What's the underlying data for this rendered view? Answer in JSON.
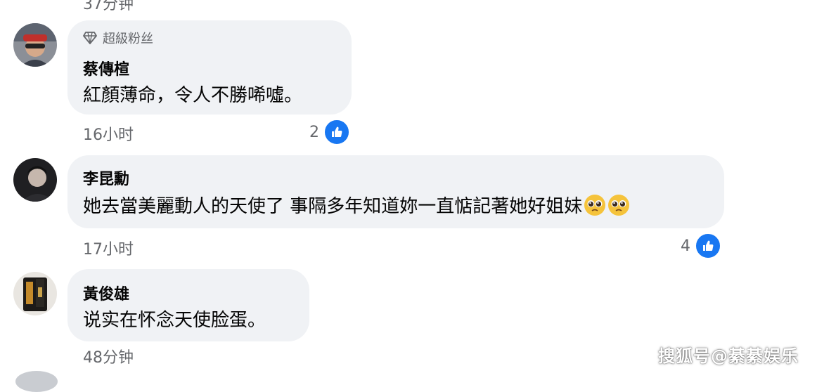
{
  "previous_comment": {
    "time": "37分钟"
  },
  "comments": [
    {
      "badge": "超級粉丝",
      "author": "蔡傳楦",
      "text": "紅顏薄命，令人不勝唏噓。",
      "time": "16小时",
      "likes": "2"
    },
    {
      "author": "李昆勳",
      "text": "她去當美麗動人的天使了 事隔多年知道妳一直惦記著她好姐妹",
      "emojis": [
        "pleading-face-emoji",
        "pleading-face-emoji"
      ],
      "time": "17小时",
      "likes": "4"
    },
    {
      "author": "黃俊雄",
      "text": "说实在怀念天使脸蛋。",
      "time": "48分钟"
    }
  ],
  "watermark": "搜狐号@綦綦娱乐",
  "colors": {
    "bubble": "#f0f2f5",
    "like_blue": "#1877f2",
    "meta_gray": "#65676b"
  }
}
